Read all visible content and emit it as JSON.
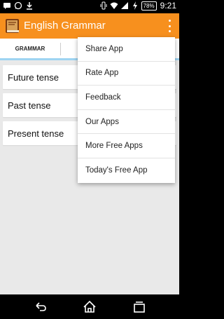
{
  "status_bar": {
    "battery": "78",
    "time": "9:21",
    "left_icons": [
      "sms-icon",
      "whatsapp-icon",
      "download-icon"
    ],
    "right_icons": [
      "vibrate-icon",
      "wifi-icon",
      "signal-icon",
      "charging-icon"
    ]
  },
  "app_bar": {
    "title": "English Grammar",
    "accent_color": "#f7901e",
    "icon": "book-icon",
    "overflow_icon": "overflow-menu-icon"
  },
  "tabs": [
    {
      "label": "GRAMMAR"
    }
  ],
  "list": {
    "items": [
      {
        "label": "Future tense"
      },
      {
        "label": "Past tense"
      },
      {
        "label": "Present tense"
      }
    ]
  },
  "menu": {
    "items": [
      {
        "label": "Share App"
      },
      {
        "label": "Rate App"
      },
      {
        "label": "Feedback"
      },
      {
        "label": "Our Apps"
      },
      {
        "label": "More Free Apps"
      },
      {
        "label": "Today's Free App"
      }
    ]
  },
  "nav_bar": {
    "buttons": [
      "back-icon",
      "home-icon",
      "recent-apps-icon"
    ]
  }
}
